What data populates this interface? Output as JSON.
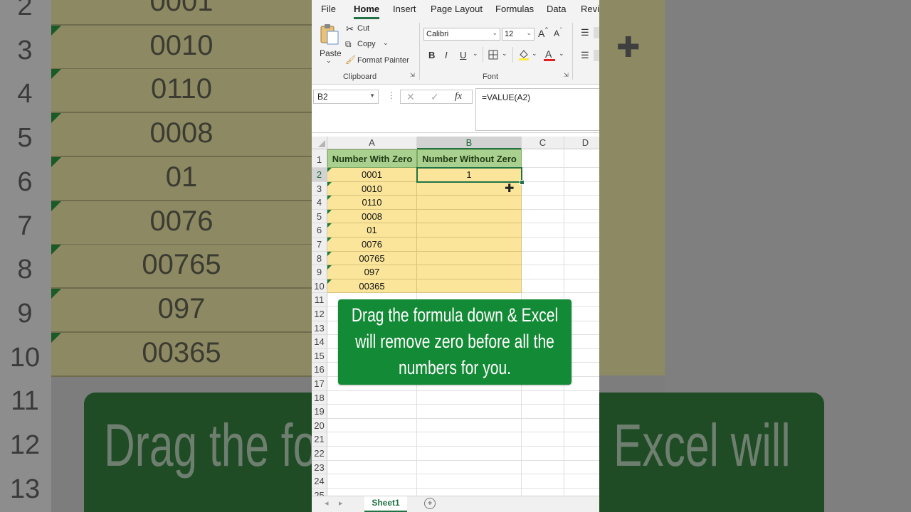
{
  "background": {
    "row_numbers": [
      "2",
      "3",
      "4",
      "5",
      "6",
      "7",
      "8",
      "9",
      "10",
      "11",
      "12",
      "13"
    ],
    "cells": [
      "0001",
      "0010",
      "0110",
      "0008",
      "01",
      "0076",
      "00765",
      "097",
      "00365"
    ],
    "banner_left": "Drag the fo",
    "banner_right": "Excel will"
  },
  "menu": {
    "items": [
      "File",
      "Home",
      "Insert",
      "Page Layout",
      "Formulas",
      "Data",
      "Revie"
    ],
    "active": "Home"
  },
  "ribbon": {
    "paste_label": "Paste",
    "cut_label": "Cut",
    "copy_label": "Copy",
    "format_painter_label": "Format Painter",
    "clipboard_group": "Clipboard",
    "font_name": "Calibri",
    "font_size": "12",
    "font_group": "Font",
    "bold": "B",
    "italic": "I",
    "underline": "U",
    "grow_font": "A",
    "shrink_font": "A",
    "font_color_glyph": "A"
  },
  "formula_bar": {
    "name_box": "B2",
    "formula": "=VALUE(A2)",
    "fx": "fx"
  },
  "grid": {
    "columns": [
      "A",
      "B",
      "C",
      "D"
    ],
    "rows": [
      "1",
      "2",
      "3",
      "4",
      "5",
      "6",
      "7",
      "8",
      "9",
      "10",
      "11",
      "12",
      "13",
      "14",
      "15",
      "16",
      "17",
      "18",
      "19",
      "20",
      "21",
      "22",
      "23",
      "24",
      "25"
    ],
    "header_a": "Number With Zero",
    "header_b": "Number Without Zero",
    "col_a_values": [
      "0001",
      "0010",
      "0110",
      "0008",
      "01",
      "0076",
      "00765",
      "097",
      "00365"
    ],
    "b2_value": "1",
    "selected_cell": "B2"
  },
  "callout": {
    "text": "Drag the formula down & Excel will remove zero before all the numbers for you."
  },
  "sheets": {
    "active": "Sheet1"
  },
  "colors": {
    "excel_green": "#217346",
    "header_fill": "#a9d08e",
    "data_fill": "#fae59a",
    "callout_bg": "#138a35"
  }
}
